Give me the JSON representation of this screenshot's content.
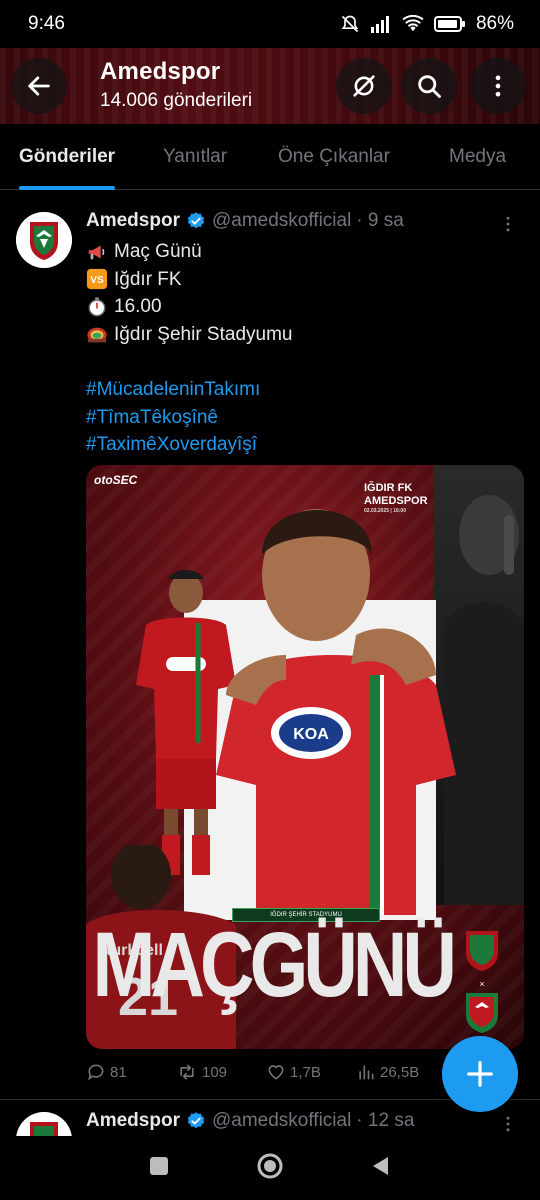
{
  "status_bar": {
    "time": "9:46",
    "battery": "86%"
  },
  "header": {
    "title": "Amedspor",
    "post_count": "14.006 gönderileri"
  },
  "tabs": [
    {
      "label": "Gönderiler"
    },
    {
      "label": "Yanıtlar"
    },
    {
      "label": "Öne Çıkanlar"
    },
    {
      "label": "Medya"
    }
  ],
  "tweet": {
    "name": "Amedspor",
    "handle": "@amedskofficial",
    "time": "· 9 sa",
    "lines": [
      "Maç Günü",
      "Iğdır FK",
      "16.00",
      "Iğdır Şehir Stadyumu"
    ],
    "hashtags": [
      "#MücadeleninTakımı",
      "#TîmaTêkoşînê",
      "#TaximêXoverdayîşî"
    ],
    "media": {
      "sponsor": "otoSEC",
      "match_line1": "IĞDIR FK",
      "match_line2": "AMEDSPOR",
      "match_line3": "02.03.2025 | 16:00",
      "stadium": "IĞDIR ŞEHİR STADYUMU",
      "big_text": "MAÇGÜNÜ",
      "jersey_sponsor": "KOA",
      "player_number": "21",
      "away_shirt_text": "turkcell"
    },
    "stats": {
      "replies": "81",
      "reposts": "109",
      "likes": "1,7B",
      "views": "26,5B"
    }
  },
  "next_tweet": {
    "name": "Amedspor",
    "handle": "@amedskofficial",
    "time": "· 12 sa"
  },
  "colors": {
    "accent": "#1d9bf0",
    "muted": "#71767b",
    "brand_red": "#b3141c",
    "brand_green": "#1b7a3a"
  }
}
